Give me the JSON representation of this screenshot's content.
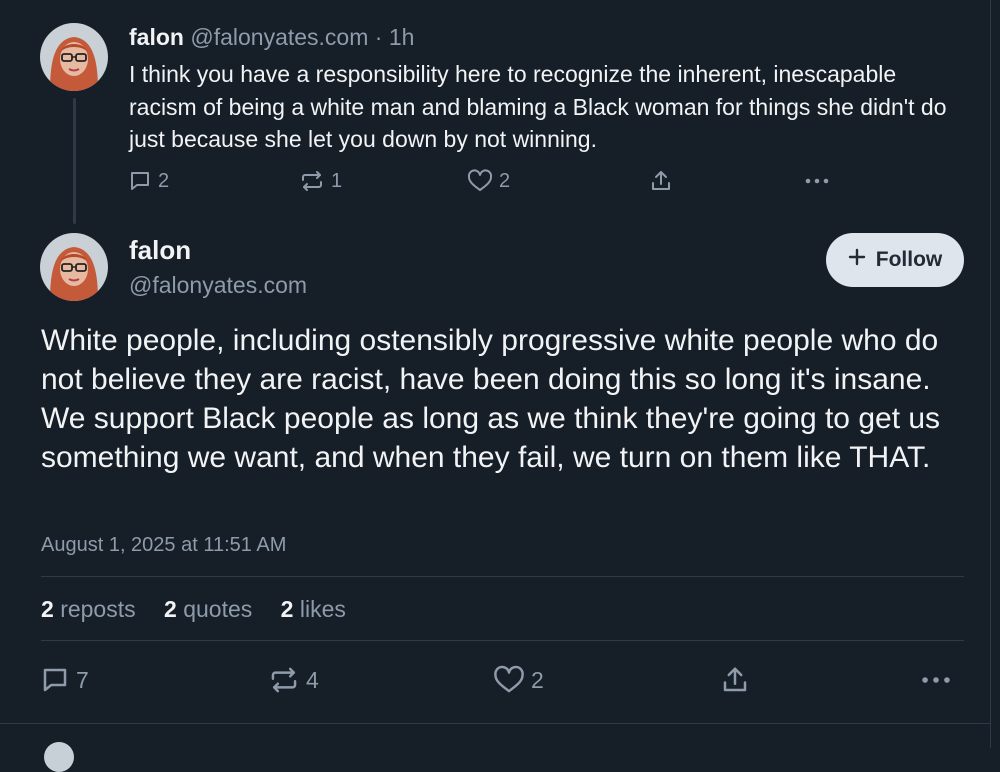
{
  "parent_post": {
    "display_name": "falon",
    "handle": "@falonyates.com",
    "separator": "·",
    "time_ago": "1h",
    "text": "I think you have a responsibility here to recognize the inherent, inescapable racism of being a white man and blaming a Black woman for things she didn't do just because she let you down by not winning.",
    "reply_count": "2",
    "repost_count": "1",
    "like_count": "2"
  },
  "main_post": {
    "display_name": "falon",
    "handle": "@falonyates.com",
    "follow_label": "Follow",
    "text": "White people, including ostensibly progressive white people who do not believe they are racist, have been doing this so long it's insane. We support Black people as long as we think they're going to get us something we want, and when they fail, we turn on them like THAT.",
    "timestamp": "August 1, 2025 at 11:51 AM",
    "stats": {
      "reposts_num": "2",
      "reposts_label": "reposts",
      "quotes_num": "2",
      "quotes_label": "quotes",
      "likes_num": "2",
      "likes_label": "likes"
    },
    "reply_count": "7",
    "repost_count": "4",
    "like_count": "2"
  },
  "colors": {
    "background": "#161e27",
    "text": "#f1f3f5",
    "muted": "#8d9bab",
    "border": "#2e3a47",
    "follow_bg": "#dfe5ec"
  },
  "icons": [
    "reply-icon",
    "repost-icon",
    "like-icon",
    "share-icon",
    "more-icon",
    "plus-icon"
  ]
}
